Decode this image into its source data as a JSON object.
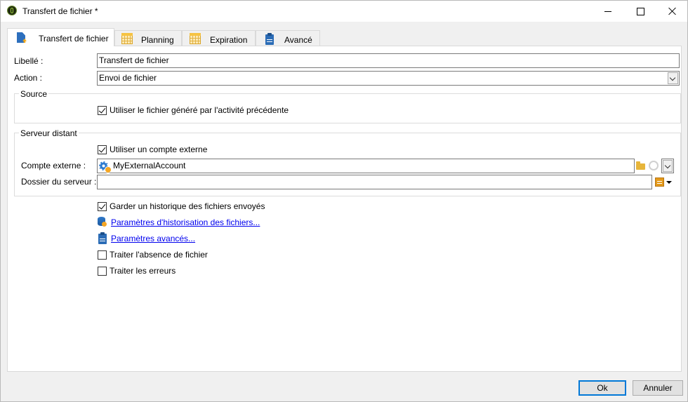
{
  "window": {
    "title": "Transfert de fichier *"
  },
  "tabs": [
    {
      "label": "Transfert de fichier",
      "icon": "file-upload-icon",
      "active": true
    },
    {
      "label": "Planning",
      "icon": "calendar-icon",
      "active": false
    },
    {
      "label": "Expiration",
      "icon": "calendar-icon",
      "active": false
    },
    {
      "label": "Avancé",
      "icon": "clipboard-icon",
      "active": false
    }
  ],
  "form": {
    "libelle_label": "Libellé :",
    "libelle_value": "Transfert de fichier",
    "action_label": "Action :",
    "action_value": "Envoi de fichier"
  },
  "source": {
    "title": "Source",
    "use_previous_label": "Utiliser le fichier généré par l'activité précédente",
    "use_previous_checked": true
  },
  "remote_server": {
    "title": "Serveur distant",
    "use_external_label": "Utiliser un compte externe",
    "use_external_checked": true,
    "account_label": "Compte externe :",
    "account_value": "MyExternalAccount",
    "folder_label": "Dossier du serveur :",
    "folder_value": ""
  },
  "options": {
    "keep_history_label": "Garder un historique des fichiers envoyés",
    "keep_history_checked": true,
    "history_params_link": "Paramètres d'historisation des fichiers...",
    "advanced_params_link": "Paramètres avancés...",
    "handle_missing_label": "Traiter l'absence de fichier",
    "handle_missing_checked": false,
    "handle_errors_label": "Traiter les erreurs",
    "handle_errors_checked": false
  },
  "buttons": {
    "ok": "Ok",
    "cancel": "Annuler"
  },
  "colors": {
    "link": "#0000ee",
    "default_button_border": "#0078d7"
  }
}
